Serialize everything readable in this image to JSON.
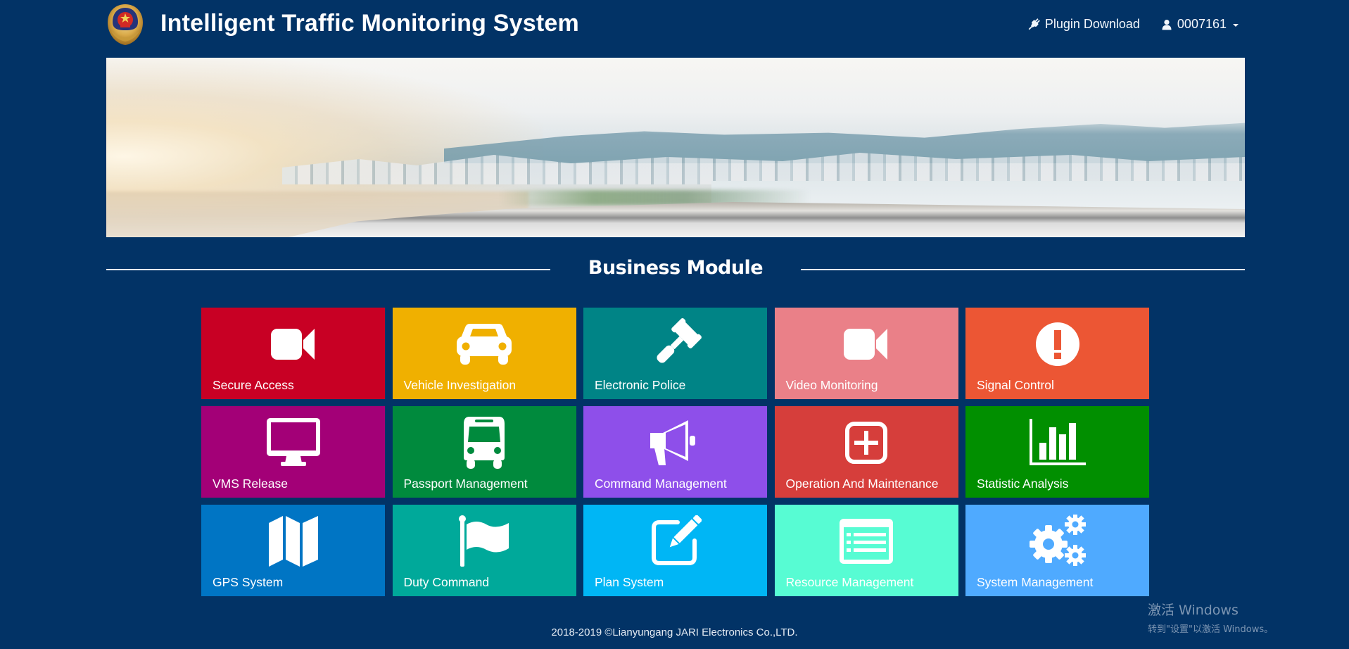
{
  "header": {
    "logo_icon": "police-emblem-icon",
    "title": "Intelligent Traffic Monitoring System",
    "plugin_download": {
      "label": "Plugin Download",
      "icon": "plug-icon"
    },
    "user": {
      "label": "0007161",
      "icon": "user-icon",
      "dropdown_icon": "caret-down-icon"
    }
  },
  "banner": {
    "description": "City skyline with motion-blurred highway",
    "carousel": {
      "slide_count": 2,
      "active_index": 1
    }
  },
  "section": {
    "title": "Business Module"
  },
  "colors": {
    "page_background": "#023366",
    "text": "#ffffff"
  },
  "modules": [
    {
      "label": "Secure Access",
      "icon": "video-camera-icon",
      "color": "#c80024"
    },
    {
      "label": "Vehicle Investigation",
      "icon": "car-icon",
      "color": "#f0b000"
    },
    {
      "label": "Electronic Police",
      "icon": "gavel-icon",
      "color": "#008486"
    },
    {
      "label": "Video Monitoring",
      "icon": "video-camera-icon",
      "color": "#ea8088"
    },
    {
      "label": "Signal Control",
      "icon": "exclamation-circle-icon",
      "color": "#ec5634"
    },
    {
      "label": "VMS Release",
      "icon": "monitor-icon",
      "color": "#a30077"
    },
    {
      "label": "Passport Management",
      "icon": "bus-icon",
      "color": "#008a3d"
    },
    {
      "label": "Command Management",
      "icon": "bullhorn-icon",
      "color": "#8e4fea"
    },
    {
      "label": "Operation And Maintenance",
      "icon": "plus-square-icon",
      "color": "#d63e3b"
    },
    {
      "label": "Statistic Analysis",
      "icon": "bar-chart-icon",
      "color": "#018f00"
    },
    {
      "label": "GPS System",
      "icon": "map-icon",
      "color": "#0075c4"
    },
    {
      "label": "Duty Command",
      "icon": "flag-icon",
      "color": "#00a99a"
    },
    {
      "label": "Plan System",
      "icon": "edit-icon",
      "color": "#00b6f5"
    },
    {
      "label": "Resource Management",
      "icon": "list-alt-icon",
      "color": "#57fcd3"
    },
    {
      "label": "System Management",
      "icon": "cogs-icon",
      "color": "#4faaff"
    }
  ],
  "footer": {
    "copyright": "2018-2019  ©Lianyungang JARI Electronics Co.,LTD."
  },
  "os_watermark": {
    "line1": "激活 Windows",
    "line2": "转到\"设置\"以激活 Windows。"
  }
}
